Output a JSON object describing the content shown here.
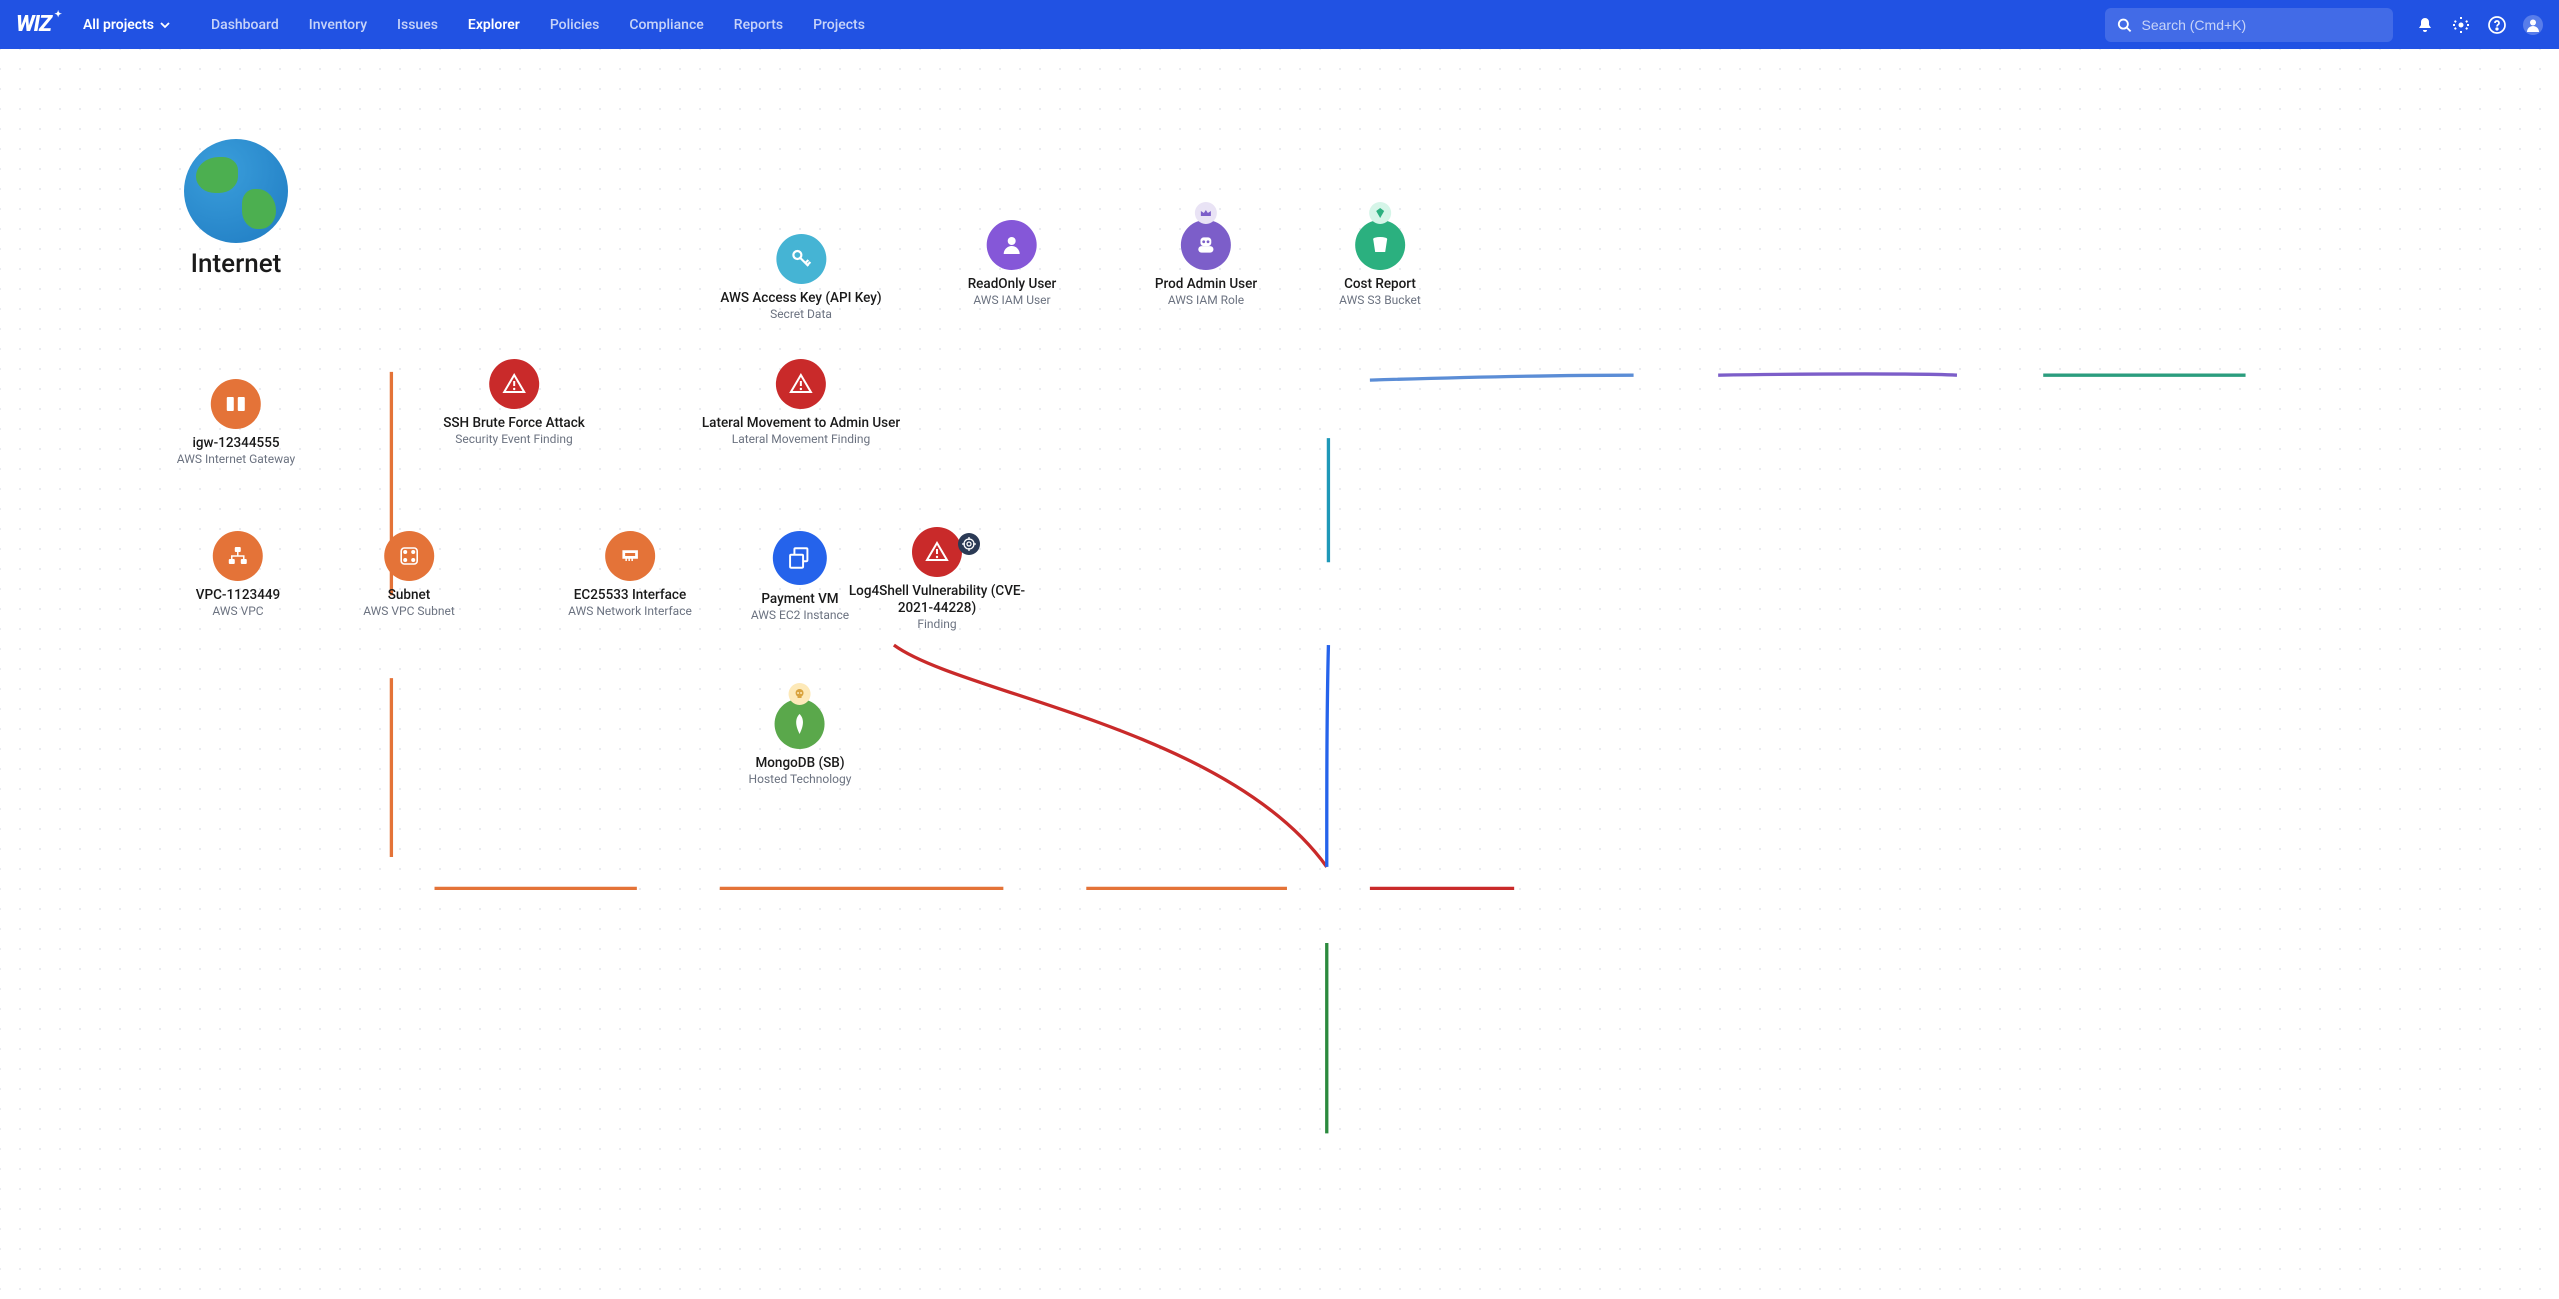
{
  "header": {
    "logo": "WIZ",
    "project_selector": "All projects",
    "nav": [
      "Dashboard",
      "Inventory",
      "Issues",
      "Explorer",
      "Policies",
      "Compliance",
      "Reports",
      "Projects"
    ],
    "active_nav": "Explorer",
    "search_placeholder": "Search (Cmd+K)"
  },
  "nodes": {
    "internet": {
      "title": "Internet"
    },
    "igw": {
      "title": "igw-12344555",
      "sub": "AWS Internet Gateway"
    },
    "vpc": {
      "title": "VPC-1123449",
      "sub": "AWS VPC"
    },
    "subnet": {
      "title": "Subnet",
      "sub": "AWS VPC Subnet"
    },
    "eni": {
      "title": "EC25533 Interface",
      "sub": "AWS Network Interface"
    },
    "payment_vm": {
      "title": "Payment VM",
      "sub": "AWS EC2 Instance"
    },
    "ssh": {
      "title": "SSH Brute Force Attack",
      "sub": "Security Event Finding"
    },
    "lateral": {
      "title": "Lateral Movement to Admin User",
      "sub": "Lateral Movement Finding"
    },
    "log4shell": {
      "title": "Log4Shell Vulnerability (CVE-2021-44228)",
      "sub": "Finding"
    },
    "mongodb": {
      "title": "MongoDB (SB)",
      "sub": "Hosted Technology"
    },
    "access_key": {
      "title": "AWS Access Key (API Key)",
      "sub": "Secret Data"
    },
    "ro_user": {
      "title": "ReadOnly User",
      "sub": "AWS IAM User"
    },
    "admin_user": {
      "title": "Prod Admin User",
      "sub": "AWS IAM Role"
    },
    "cost_report": {
      "title": "Cost Report",
      "sub": "AWS S3 Bucket"
    }
  }
}
